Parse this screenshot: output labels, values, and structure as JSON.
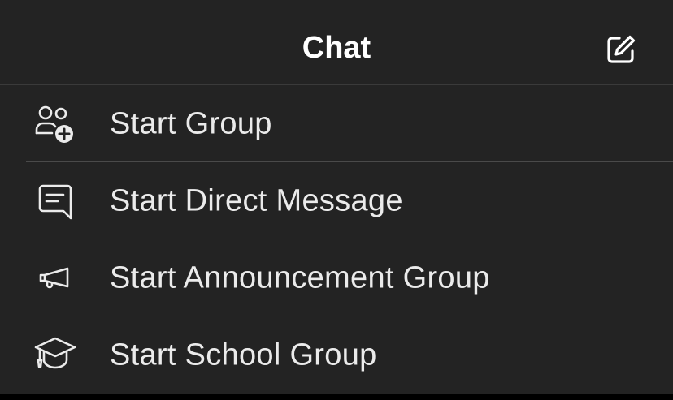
{
  "header": {
    "title": "Chat",
    "compose_icon": "compose-icon"
  },
  "menu": {
    "items": [
      {
        "label": "Start Group",
        "icon": "group-add-icon"
      },
      {
        "label": "Start Direct Message",
        "icon": "message-icon"
      },
      {
        "label": "Start Announcement Group",
        "icon": "megaphone-icon"
      },
      {
        "label": "Start School Group",
        "icon": "graduation-cap-icon"
      }
    ]
  },
  "colors": {
    "background": "#232323",
    "text": "#ebebeb",
    "title": "#ffffff",
    "divider": "#4a4a4a"
  }
}
